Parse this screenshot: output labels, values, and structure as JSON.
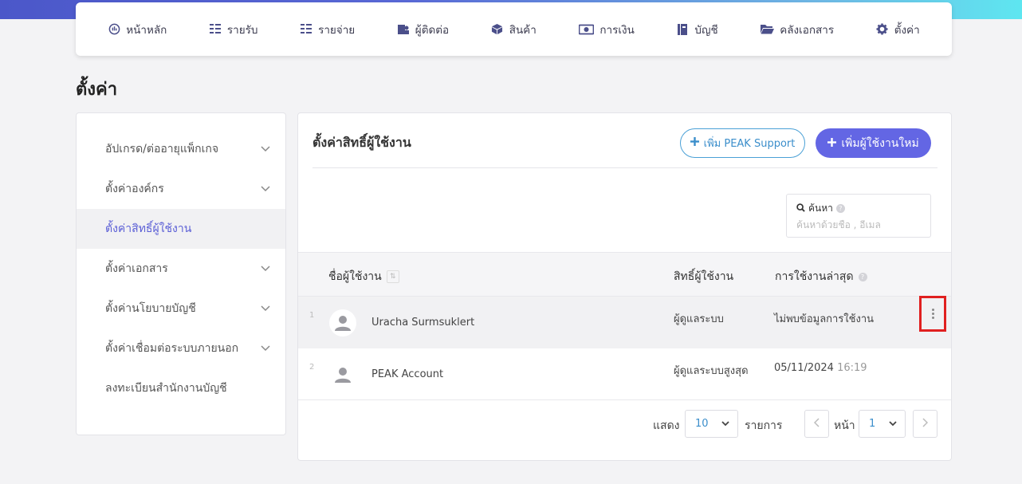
{
  "nav": {
    "items": [
      {
        "label": "หน้าหลัก",
        "icon": "dashboard-icon"
      },
      {
        "label": "รายรับ",
        "icon": "income-list-icon"
      },
      {
        "label": "รายจ่าย",
        "icon": "expense-list-icon"
      },
      {
        "label": "ผู้ติดต่อ",
        "icon": "contacts-icon"
      },
      {
        "label": "สินค้า",
        "icon": "box-icon"
      },
      {
        "label": "การเงิน",
        "icon": "money-icon"
      },
      {
        "label": "บัญชี",
        "icon": "book-icon"
      },
      {
        "label": "คลังเอกสาร",
        "icon": "folder-icon"
      },
      {
        "label": "ตั้งค่า",
        "icon": "gear-icon"
      }
    ]
  },
  "page": {
    "title": "ตั้งค่า"
  },
  "sidebar": {
    "items": [
      {
        "label": "อัปเกรด/ต่ออายุแพ็กเกจ",
        "chevron": true
      },
      {
        "label": "ตั้งค่าองค์กร",
        "chevron": true
      },
      {
        "label": "ตั้งค่าสิทธิ์ผู้ใช้งาน",
        "chevron": false,
        "active": true
      },
      {
        "label": "ตั้งค่าเอกสาร",
        "chevron": true
      },
      {
        "label": "ตั้งค่านโยบายบัญชี",
        "chevron": true
      },
      {
        "label": "ตั้งค่าเชื่อมต่อระบบภายนอก",
        "chevron": true
      },
      {
        "label": "ลงทะเบียนสำนักงานบัญชี",
        "chevron": false
      }
    ]
  },
  "panel": {
    "title": "ตั้งค่าสิทธิ์ผู้ใช้งาน",
    "support_button": "เพิ่ม PEAK Support",
    "add_user_button": "เพิ่มผู้ใช้งานใหม่",
    "search": {
      "label": "ค้นหา",
      "placeholder": "ค้นหาด้วยชื่อ , อีเมล"
    },
    "table": {
      "headers": {
        "name": "ชื่อผู้ใช้งาน",
        "role": "สิทธิ์ผู้ใช้งาน",
        "last_used": "การใช้งานล่าสุด"
      },
      "rows": [
        {
          "num": "1",
          "name": "Uracha Surmsuklert",
          "role": "ผู้ดูแลระบบ",
          "last_used": "ไม่พบข้อมูลการใช้งาน",
          "last_time": ""
        },
        {
          "num": "2",
          "name": "PEAK Account",
          "role": "ผู้ดูแลระบบสูงสุด",
          "last_used": "05/11/2024",
          "last_time": "16:19"
        }
      ]
    },
    "pager": {
      "show_label": "แสดง",
      "per_page": "10",
      "items_label": "รายการ",
      "page_label": "หน้า",
      "page": "1"
    }
  },
  "colors": {
    "accent": "#6366e4",
    "support": "#3b8ecb",
    "highlight": "#e02020"
  }
}
